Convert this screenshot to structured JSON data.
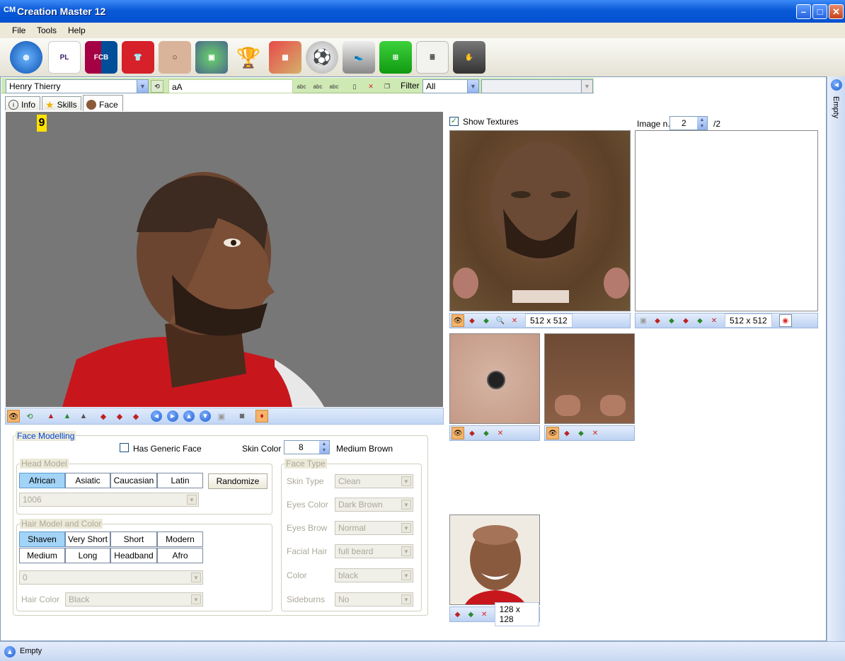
{
  "window": {
    "title": "Creation Master 12",
    "logo_text": "CM"
  },
  "menu": [
    "File",
    "Tools",
    "Help"
  ],
  "toolbar_icons": [
    "globe-icon",
    "premier-league-icon",
    "fc-barcelona-icon",
    "jersey-icon",
    "player-face-icon",
    "stadium-icon",
    "world-cup-trophy-icon",
    "cards-icon",
    "ball-icon",
    "boots-icon",
    "pitch-icon",
    "newspaper-icon",
    "goalkeeper-glove-icon"
  ],
  "player_bar": {
    "player": "Henry Thierry",
    "font_button": "aA",
    "filter_label": "Filter",
    "filter_value": "All",
    "abc_label": "abc"
  },
  "tabs": [
    {
      "label": "Info",
      "icon": "info-icon"
    },
    {
      "label": "Skills",
      "icon": "star-icon"
    },
    {
      "label": "Face",
      "icon": "face-icon"
    }
  ],
  "viewport": {
    "badge": "9"
  },
  "face_modelling": {
    "title": "Face Modelling",
    "generic_face_label": "Has Generic Face",
    "skin_color_label": "Skin Color",
    "skin_color_value": "8",
    "skin_color_name": "Medium Brown",
    "head_model": {
      "title": "Head Model",
      "options": [
        "African",
        "Asiatic",
        "Caucasian",
        "Latin"
      ],
      "selected": "African",
      "randomize": "Randomize",
      "model_value": "1006"
    },
    "hair": {
      "title": "Hair Model and Color",
      "options": [
        "Shaven",
        "Very Short",
        "Short",
        "Modern",
        "Medium",
        "Long",
        "Headband",
        "Afro"
      ],
      "selected": "Shaven",
      "model_value": "0",
      "color_label": "Hair Color",
      "color_value": "Black"
    },
    "face_type": {
      "title": "Face Type",
      "fields": [
        {
          "label": "Skin Type",
          "value": "Clean"
        },
        {
          "label": "Eyes Color",
          "value": "Dark Brown"
        },
        {
          "label": "Eyes Brow",
          "value": "Normal"
        },
        {
          "label": "Facial Hair",
          "value": "full beard"
        },
        {
          "label": "Color",
          "value": "black"
        },
        {
          "label": "Sideburns",
          "value": "No"
        }
      ]
    }
  },
  "textures": {
    "show_textures": "Show Textures",
    "image_n_label": "Image n.",
    "image_n_value": "2",
    "image_n_total": "/2",
    "main_size": "512 x 512",
    "second_size": "512 x 512",
    "photo_size": "128 x 128"
  },
  "dock": {
    "label": "Empty"
  },
  "status": {
    "text": "Empty"
  }
}
